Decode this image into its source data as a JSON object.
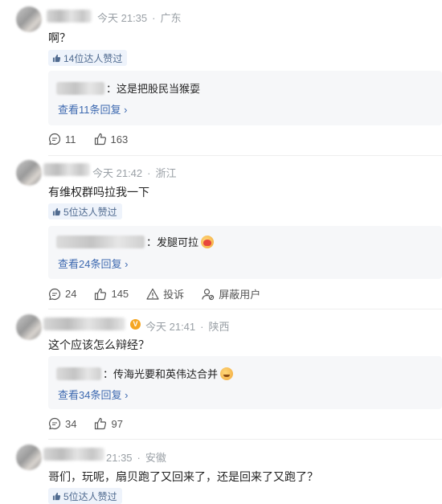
{
  "comments": [
    {
      "time": "今天 21:35",
      "location": "广东",
      "text": "啊？",
      "likes_badge": "14位达人赞过",
      "reply_text": "这是把股民当猴耍",
      "view_replies": "查看11条回复",
      "comment_count": "11",
      "like_count": "163"
    },
    {
      "time": "今天 21:42",
      "location": "浙江",
      "text": "有维权群吗拉我一下",
      "likes_badge": "5位达人赞过",
      "reply_text": "发腿可拉",
      "view_replies": "查看24条回复",
      "comment_count": "24",
      "like_count": "145",
      "report_label": "投诉",
      "block_label": "屏蔽用户"
    },
    {
      "time": "今天 21:41",
      "location": "陕西",
      "text": "这个应该怎么辩经？",
      "reply_text": "传海光要和英伟达合并",
      "view_replies": "查看34条回复",
      "comment_count": "34",
      "like_count": "97"
    },
    {
      "time": "21:35",
      "location": "安徽",
      "text": "哥们，玩呢，扇贝跑了又回来了，还是回来了又跑了？",
      "likes_badge": "5位达人赞过"
    }
  ],
  "colors": {
    "link": "#3d69b0",
    "meta": "#9aa0a6",
    "badge_bg": "#eef3fb",
    "reply_bg": "#f6f7f9"
  }
}
